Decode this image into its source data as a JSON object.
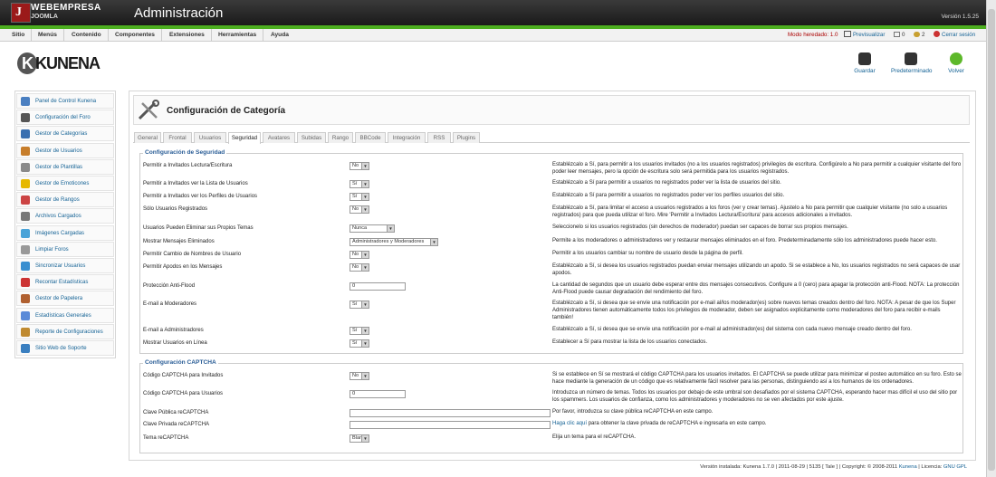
{
  "header": {
    "brand_line1": "WEBEMPRESA",
    "brand_line2": "JOOMLA",
    "title": "Administración",
    "version": "Versión 1.5.25"
  },
  "menu": [
    "Sitio",
    "Menús",
    "Contenido",
    "Componentes",
    "Extensiones",
    "Herramientas",
    "Ayuda"
  ],
  "statusbar": {
    "mode": "Modo heredado: 1.0",
    "preview": "Previsualizar",
    "messages": "0",
    "users": "2",
    "logout": "Cerrar sesión"
  },
  "logo": "KUNENA",
  "toolbar": {
    "save": "Guardar",
    "default": "Predeterminado",
    "back": "Volver"
  },
  "sidebar": [
    {
      "label": "Panel de Control Kunena"
    },
    {
      "label": "Configuración del Foro"
    },
    {
      "label": "Gestor de Categorías"
    },
    {
      "label": "Gestor de Usuarios"
    },
    {
      "label": "Gestor de Plantillas"
    },
    {
      "label": "Gestor de Emoticones"
    },
    {
      "label": "Gestor de Rangos"
    },
    {
      "label": "Archivos Cargados"
    },
    {
      "label": "Imágenes Cargadas"
    },
    {
      "label": "Limpiar Foros"
    },
    {
      "label": "Sincronizar Usuarios"
    },
    {
      "label": "Recontar Estadísticas"
    },
    {
      "label": "Gestor de Papelera"
    },
    {
      "label": "Estadísticas Generales"
    },
    {
      "label": "Reporte de Configuraciones"
    },
    {
      "label": "Sitio Web de Soporte"
    }
  ],
  "page_title": "Configuración de Categoría",
  "tabs": [
    "General",
    "Frontal",
    "Usuarios",
    "Seguridad",
    "Avatares",
    "Subidas",
    "Rango",
    "BBCode",
    "Integración",
    "RSS",
    "Plugins"
  ],
  "active_tab": "Seguridad",
  "security": {
    "legend": "Configuración de Seguridad",
    "rows": [
      {
        "label": "Permitir a Invitados Lectura/Escritura",
        "value": "No",
        "desc": "Establézcalo a Sí, para permitir a los usuarios invitados (no a los usuarios registrados) privilegios de escritura. Configúrelo a No para permitir a cualquier visitante del foro poder leer mensajes, pero la opción de escritura solo será permitida para los usuarios registrados."
      },
      {
        "label": "Permitir a Invitados ver la Lista de Usuarios",
        "value": "Sí",
        "desc": "Establézcalo a Sí para permitir a usuarios no registrados poder ver la lista de usuarios del sitio."
      },
      {
        "label": "Permitir a Invitados ver los Perfiles de Usuarios",
        "value": "Sí",
        "desc": "Establézcalo a Sí para permitir a usuarios no registrados poder ver los perfiles usuarios del sitio."
      },
      {
        "label": "Sólo Usuarios Registrados",
        "value": "No",
        "desc": "Establézcalo a Sí, para limitar el acceso a usuarios registrados a los foros (ver y crear temas). Ajustelo a No para permitir que cualquier visitante (no solo a usuarios registrados) para que pueda utilizar el foro. Mire 'Permitir a Invitados Lectura/Escritura' para accesos adicionales a invitados."
      },
      {
        "label": "Usuarios Pueden Eliminar sus Propios Temas",
        "value": "Nunca",
        "desc": "Seleccionelo si los usuarios registrados (sin derechos de moderador) puedan ser capaces de borrar sus propios mensajes."
      },
      {
        "label": "Mostrar Mensajes Eliminados",
        "value": "Administradores y Moderadores",
        "desc": "Permite a los moderadores o administradores ver y restaurar mensajes eliminados en el foro. Predeterminadamente sólo los administradores puede hacer esto."
      },
      {
        "label": "Permitir Cambio de Nombres de Usuario",
        "value": "No",
        "desc": "Permitir a los usuarios cambiar su nombre de usuario desde la página de perfil."
      },
      {
        "label": "Permitir Apodos en los Mensajes",
        "value": "No",
        "desc": "Establézcalo a Sí, si desea los usuarios registrados puedan enviar mensajes utilizando un apodo. Si se establece a No, los usuarios registrados no será capaces de usar apodos."
      },
      {
        "label": "Protección Anti-Flood",
        "value": "0",
        "desc": "La cantidad de segundos que un usuario debe esperar entre dos mensajes consecutivos. Configure a 0 (cero) para apagar la protección anti-Flood. NOTA: La protección Anti-Flood puede causar degradación del rendimiento del foro."
      },
      {
        "label": "E-mail a Moderadores",
        "value": "Sí",
        "desc": "Establézcalo a Sí, si desea que se envíe una notificación por e-mail al/los moderador(es) sobre nuevos temas creados dentro del foro. NOTA: A pesar de que los Super Administradores tienen automáticamente todos los privilegios de moderador, deben ser asignados explicitamente como moderadores del foro para recibir e-mails también!"
      },
      {
        "label": "E-mail a Administradores",
        "value": "Sí",
        "desc": "Establézcalo a Sí, si desea que se envíe una notificación por e-mail al administrador(es) del sistema con cada nuevo mensaje creado dentro del foro."
      },
      {
        "label": "Mostrar Usuarios en Línea",
        "value": "Sí",
        "desc": "Establecer a Sí para mostrar la lista de los usuarios conectados."
      }
    ]
  },
  "captcha": {
    "legend": "Configuración CAPTCHA",
    "rows": [
      {
        "label": "Código CAPTCHA para Invitados",
        "value": "No",
        "desc": "Si se establece en Sí se mostrará el código CAPTCHA para los usuarios invitados. El CAPTCHA se puede utilizar para minimizar el posteo automático en su foro. Esto se hace mediante la generación de un código que es relativamente fácil resolver para las personas, distinguiendo así a los humanos de los ordenadores."
      },
      {
        "label": "Código CAPTCHA para Usuarios",
        "value": "0",
        "desc": "Introduzca un número de temas. Todos los usuarios por debajo de este umbral son desafiados por el sistema CAPTCHA, esperando hacer mas difícil el uso del sitio por los spammers. Los usuarios de confianza, como los administradores y moderadores no se ven afectados por este ajuste."
      },
      {
        "label": "Clave Pública reCAPTCHA",
        "value": "",
        "desc": "Por favor, introduzca su clave pública reCAPTCHA en este campo."
      },
      {
        "label": "Clave Privada reCAPTCHA",
        "value": "",
        "desc_link": "Haga clic aquí",
        "desc": " para obtener la clave privada de reCAPTCHA e ingresarla en este campo."
      },
      {
        "label": "Tema reCAPTCHA",
        "value": "Blanco",
        "desc": "Elija un tema para el reCAPTCHA."
      }
    ]
  },
  "footer": {
    "text": "Versión instalada: Kunena 1.7.0 | 2011-08-29 | 5135 [ Tale ] | Copyright: © 2008-2011 ",
    "link1": "Kunena",
    "text2": " | Licencia: ",
    "link2": "GNU GPL"
  },
  "colors": {
    "accent_green": "#4cae1f",
    "link": "#146295",
    "header": "#2a2a2a",
    "legend": "#2a5d96"
  }
}
